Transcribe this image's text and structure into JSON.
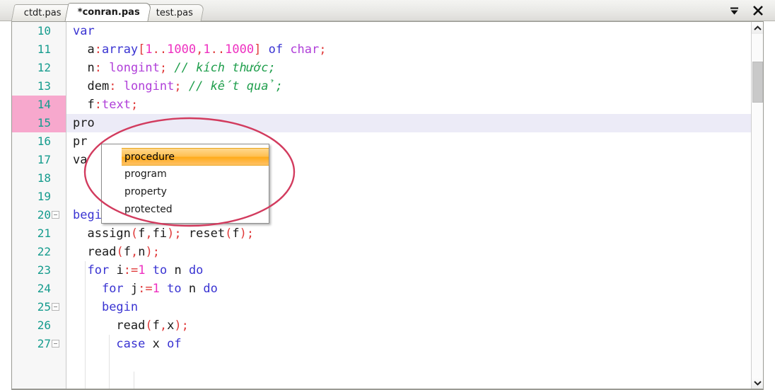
{
  "window": {
    "tabs": [
      {
        "label": "ctdt.pas",
        "active": false,
        "modified": false
      },
      {
        "label": "*conran.pas",
        "active": true,
        "modified": true
      },
      {
        "label": "test.pas",
        "active": false,
        "modified": false
      }
    ],
    "actions": [
      {
        "name": "tab-list-dropdown",
        "glyph": "▼"
      },
      {
        "name": "close-editor",
        "glyph": "✕"
      }
    ]
  },
  "colors": {
    "keyword": "#3a34d2",
    "type": "#b03fd9",
    "number": "#ee2fc0",
    "bracket": "#e03b3b",
    "comment": "#1f9e4c",
    "line_number": "#169c8e",
    "gutter_highlight": "#f7a8cd",
    "current_line": "#ecebf7",
    "annotation": "#d23b5e",
    "selection_highlight": "#ffab1b"
  },
  "editor": {
    "lines": [
      {
        "num": "10",
        "gutter_highlight": false,
        "current": false,
        "fold": false,
        "text": "var"
      },
      {
        "num": "11",
        "gutter_highlight": false,
        "current": false,
        "fold": false,
        "text": "  a:array[1..1000,1..1000] of char;"
      },
      {
        "num": "12",
        "gutter_highlight": false,
        "current": false,
        "fold": false,
        "text": "  n: longint; // kích thước;"
      },
      {
        "num": "13",
        "gutter_highlight": false,
        "current": false,
        "fold": false,
        "text": "  dem: longint; // kết quả;"
      },
      {
        "num": "14",
        "gutter_highlight": true,
        "current": false,
        "fold": false,
        "text": "  f:text;"
      },
      {
        "num": "15",
        "gutter_highlight": true,
        "current": true,
        "fold": false,
        "text": "pro"
      },
      {
        "num": "16",
        "gutter_highlight": false,
        "current": false,
        "fold": false,
        "text": "pr"
      },
      {
        "num": "17",
        "gutter_highlight": false,
        "current": false,
        "fold": false,
        "text": "va"
      },
      {
        "num": "18",
        "gutter_highlight": false,
        "current": false,
        "fold": false,
        "text": ""
      },
      {
        "num": "19",
        "gutter_highlight": false,
        "current": false,
        "fold": false,
        "text": ""
      },
      {
        "num": "20",
        "gutter_highlight": false,
        "current": false,
        "fold": true,
        "text": "begin"
      },
      {
        "num": "21",
        "gutter_highlight": false,
        "current": false,
        "fold": false,
        "text": "  assign(f,fi); reset(f);"
      },
      {
        "num": "22",
        "gutter_highlight": false,
        "current": false,
        "fold": false,
        "text": "  read(f,n);"
      },
      {
        "num": "23",
        "gutter_highlight": false,
        "current": false,
        "fold": false,
        "text": "  for i:=1 to n do"
      },
      {
        "num": "24",
        "gutter_highlight": false,
        "current": false,
        "fold": false,
        "text": "    for j:=1 to n do"
      },
      {
        "num": "25",
        "gutter_highlight": false,
        "current": false,
        "fold": true,
        "text": "    begin"
      },
      {
        "num": "26",
        "gutter_highlight": false,
        "current": false,
        "fold": false,
        "text": "      read(f,x);"
      },
      {
        "num": "27",
        "gutter_highlight": false,
        "current": false,
        "fold": true,
        "text": "      case x of"
      }
    ]
  },
  "autocomplete": {
    "visible": true,
    "selected_index": 0,
    "items": [
      {
        "label": "procedure"
      },
      {
        "label": "program"
      },
      {
        "label": "property"
      },
      {
        "label": "protected"
      }
    ]
  },
  "scrollbar": {
    "up_glyph": "∧",
    "down_glyph": "∨",
    "thumb_top_pct": 8,
    "thumb_height_pct": 12
  }
}
